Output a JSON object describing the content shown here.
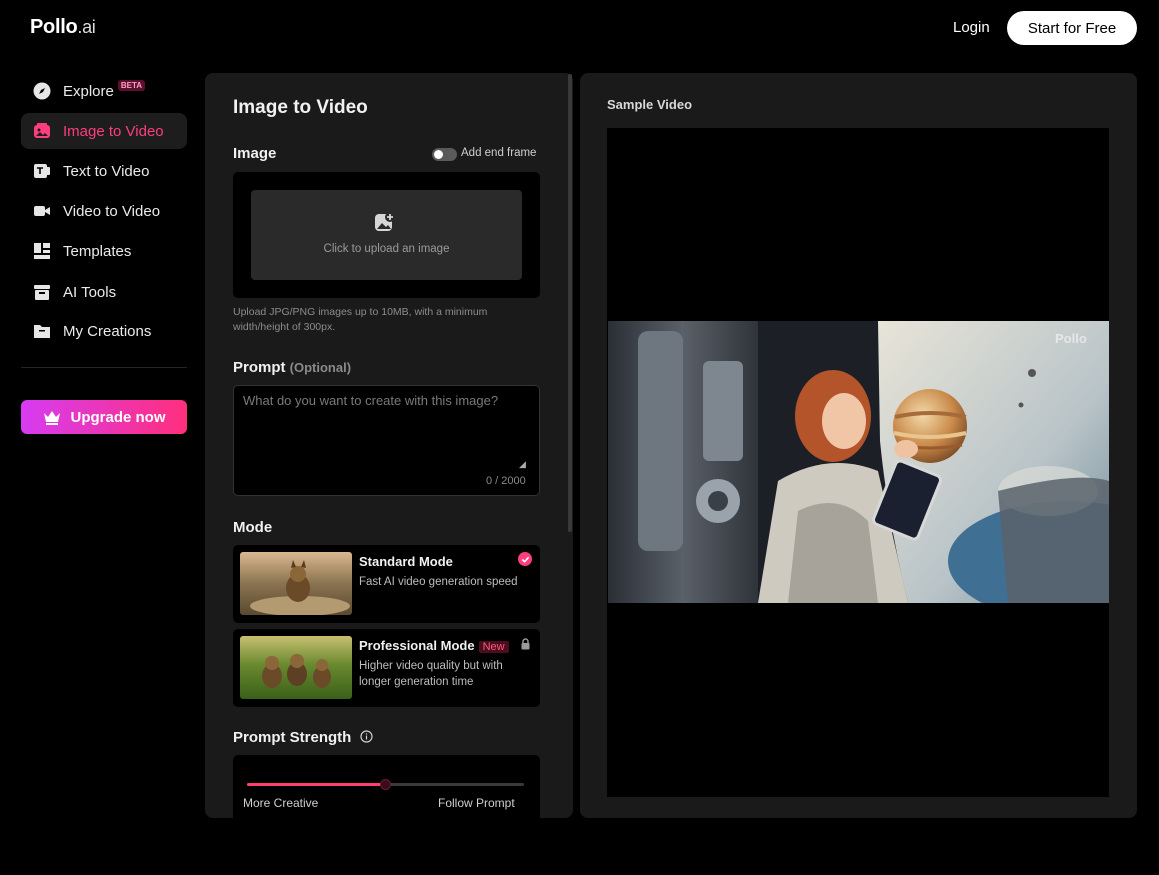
{
  "header": {
    "logo_main": "Pollo",
    "logo_suffix": ".ai",
    "login_label": "Login",
    "start_label": "Start for Free"
  },
  "sidebar": {
    "items": [
      {
        "label": "Explore",
        "icon": "compass-icon",
        "badge": "BETA"
      },
      {
        "label": "Image to Video",
        "icon": "image-video-icon",
        "active": true
      },
      {
        "label": "Text to Video",
        "icon": "text-video-icon"
      },
      {
        "label": "Video to Video",
        "icon": "video-camera-icon"
      },
      {
        "label": "Templates",
        "icon": "templates-icon"
      },
      {
        "label": "AI Tools",
        "icon": "toolbox-icon"
      },
      {
        "label": "My Creations",
        "icon": "folder-icon"
      }
    ],
    "upgrade_label": "Upgrade now"
  },
  "panel": {
    "title": "Image to Video",
    "image": {
      "label": "Image",
      "toggle_label": "Add end frame",
      "upload_text": "Click to upload an image",
      "hint": "Upload JPG/PNG images up to 10MB, with a minimum width/height of 300px."
    },
    "prompt": {
      "label": "Prompt",
      "optional": "(Optional)",
      "placeholder": "What do you want to create with this image?",
      "counter": "0 / 2000"
    },
    "mode": {
      "label": "Mode",
      "options": [
        {
          "name": "Standard Mode",
          "desc": "Fast AI video generation speed",
          "selected": true
        },
        {
          "name": "Professional Mode",
          "badge": "New",
          "desc": "Higher video quality but with longer generation time",
          "locked": true
        }
      ]
    },
    "strength": {
      "label": "Prompt Strength",
      "left_label": "More Creative",
      "right_label": "Follow Prompt",
      "value_fraction": 0.5
    }
  },
  "preview": {
    "label": "Sample Video",
    "watermark": "Pollo"
  },
  "colors": {
    "accent": "#ff3d7f",
    "panel_bg": "#1a1a1a",
    "upgrade_gradient_start": "#d63cf2",
    "upgrade_gradient_end": "#ff2f7c"
  }
}
